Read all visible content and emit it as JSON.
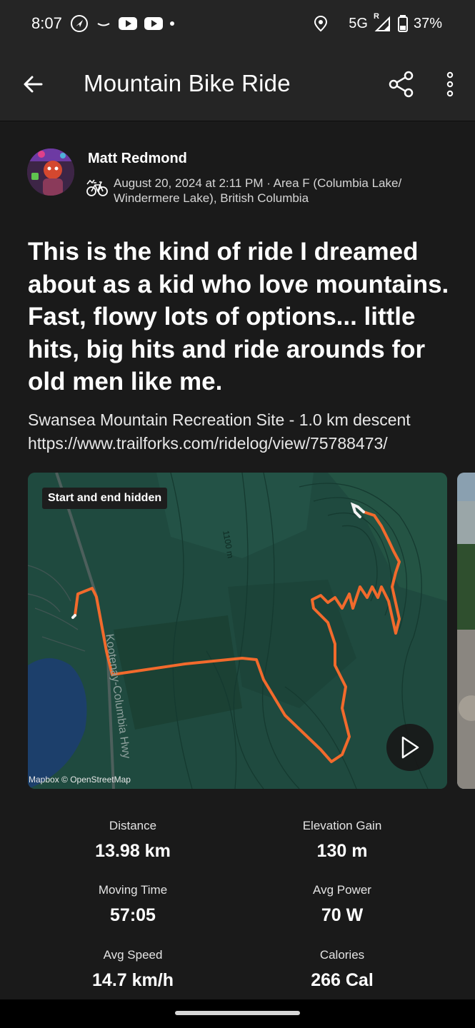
{
  "status_bar": {
    "time": "8:07",
    "network": "5G",
    "roaming": "R",
    "battery": "37%"
  },
  "app_bar": {
    "title": "Mountain Bike Ride"
  },
  "activity": {
    "athlete_name": "Matt Redmond",
    "activity_icon": "mountain-bike-icon",
    "date_location": "August 20, 2024 at 2:11 PM · Area F (Columbia Lake/ Windermere Lake), British Columbia",
    "description": "This is the kind of ride I dreamed about as a kid who love mountains. Fast, flowy lots of options... little hits, big hits and ride arounds for old men like me.",
    "trail_text": "Swansea Mountain Recreation Site - 1.0 km descent",
    "trail_url": "https://www.trailforks.com/ridelog/view/75788473/"
  },
  "map": {
    "badge": "Start and end hidden",
    "contour_label": "1100 m",
    "road_label": "Kootenay-Columbia Hwy",
    "attribution": "Mapbox © OpenStreetMap",
    "route_color": "#f26a2c",
    "base_color": "#1f4a3f"
  },
  "stats": [
    {
      "label": "Distance",
      "value": "13.98 km"
    },
    {
      "label": "Elevation Gain",
      "value": "130 m"
    },
    {
      "label": "Moving Time",
      "value": "57:05"
    },
    {
      "label": "Avg Power",
      "value": "70 W"
    },
    {
      "label": "Avg Speed",
      "value": "14.7 km/h"
    },
    {
      "label": "Calories",
      "value": "266 Cal"
    }
  ]
}
